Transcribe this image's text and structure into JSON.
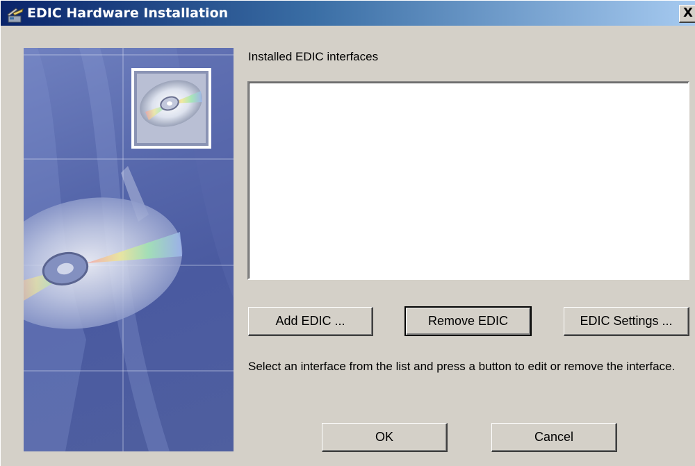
{
  "window": {
    "title": "EDIC Hardware Installation",
    "close_glyph": "X"
  },
  "main": {
    "list_label": "Installed EDIC interfaces",
    "list_items": [],
    "hint": "Select an interface from the list and press a button to edit or remove the interface."
  },
  "buttons": {
    "add": "Add EDIC ...",
    "remove": "Remove EDIC",
    "settings": "EDIC Settings ...",
    "ok": "OK",
    "cancel": "Cancel"
  },
  "icons": {
    "title": "hardware-install-icon",
    "artwork": "cd-disc-artwork"
  },
  "colors": {
    "titlebar_start": "#0a246a",
    "titlebar_end": "#a6caf0",
    "dialog_face": "#d4d0c8"
  }
}
